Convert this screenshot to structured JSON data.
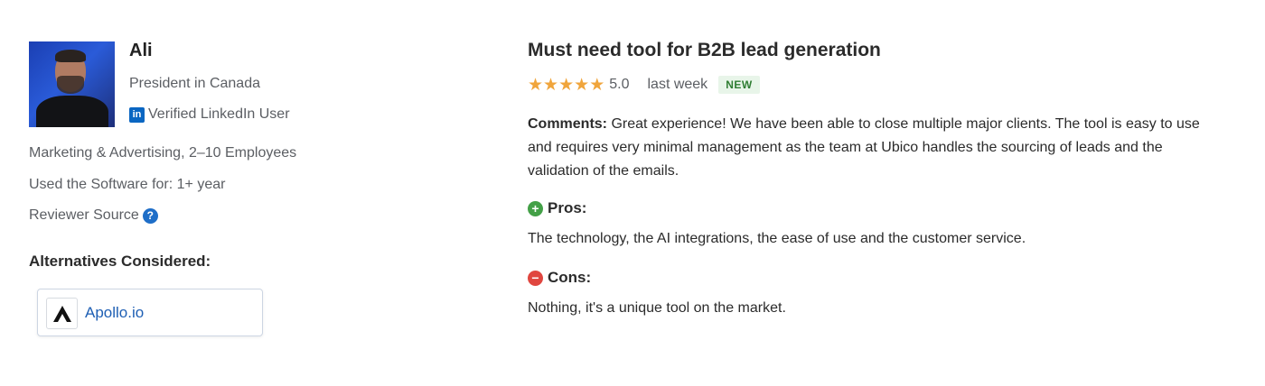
{
  "reviewer": {
    "name": "Ali",
    "title": "President in Canada",
    "verified_label": "Verified LinkedIn User",
    "industry": "Marketing & Advertising, 2–10 Employees",
    "usage": "Used the Software for: 1+ year",
    "source_label": "Reviewer Source"
  },
  "alternatives": {
    "heading": "Alternatives Considered:",
    "items": [
      {
        "name": "Apollo.io"
      }
    ]
  },
  "review": {
    "title": "Must need tool for B2B lead generation",
    "rating": 5.0,
    "rating_text": "5.0",
    "time": "last week",
    "badge": "NEW",
    "comments_label": "Comments:",
    "comments_text": "Great experience! We have been able to close multiple major clients. The tool is easy to use and requires very minimal management as the team at Ubico handles the sourcing of leads and the validation of the emails.",
    "pros_label": "Pros:",
    "pros_text": "The technology, the AI integrations, the ease of use and the customer service.",
    "cons_label": "Cons:",
    "cons_text": "Nothing, it's a unique tool on the market."
  },
  "icons": {
    "linkedin": "linkedin-icon",
    "help": "question-circle-icon",
    "star": "star-icon",
    "pros": "plus-circle-icon",
    "cons": "minus-circle-icon",
    "apollo_logo": "apollo-logo-icon"
  },
  "colors": {
    "star": "#f0a53c",
    "link": "#1e5fb4",
    "badge_text": "#2e7d32",
    "badge_bg": "#e8f5e9",
    "pros": "#43a047",
    "cons": "#e0463f",
    "linkedin": "#0a66c2"
  }
}
